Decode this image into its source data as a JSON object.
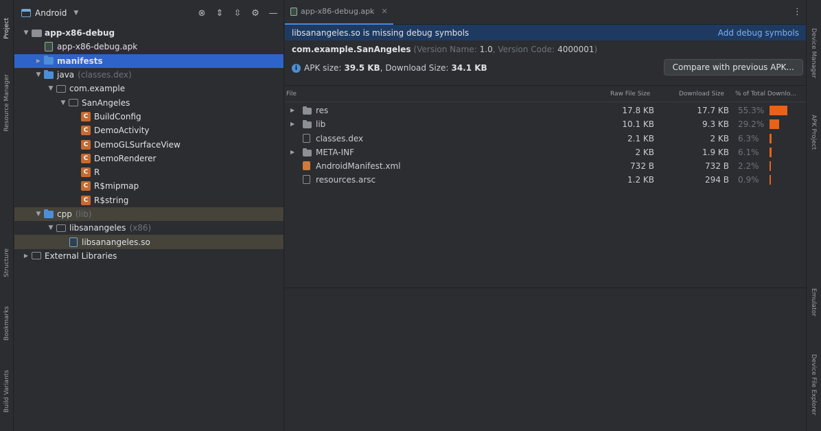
{
  "left_strip": [
    {
      "label": "Project",
      "icon": "folder-icon",
      "active": true
    },
    {
      "label": "Resource Manager",
      "icon": "resource-icon",
      "active": false
    },
    {
      "label": "Structure",
      "icon": "structure-icon",
      "active": false
    },
    {
      "label": "Bookmarks",
      "icon": "bookmark-icon",
      "active": false
    },
    {
      "label": "Build Variants",
      "icon": "build-variants-icon",
      "active": false
    }
  ],
  "right_strip": [
    {
      "label": "Device Manager",
      "icon": "device-icon"
    },
    {
      "label": "APK Project",
      "icon": "apk-icon"
    },
    {
      "label": "Emulator",
      "icon": "emulator-icon"
    },
    {
      "label": "Device File Explorer",
      "icon": "file-explorer-icon"
    }
  ],
  "project": {
    "view_label": "Android",
    "tree": [
      {
        "depth": 0,
        "arrow": "▾",
        "icon": "module",
        "name": "app-x86-debug",
        "bold": true,
        "sub": ""
      },
      {
        "depth": 1,
        "arrow": "",
        "icon": "apk",
        "name": "app-x86-debug.apk",
        "bold": false,
        "sub": ""
      },
      {
        "depth": 1,
        "arrow": "›",
        "icon": "folder-blue",
        "name": "manifests",
        "bold": true,
        "sub": "",
        "selected": true
      },
      {
        "depth": 1,
        "arrow": "▾",
        "icon": "folder-blue",
        "name": "java",
        "bold": false,
        "sub": "(classes.dex)"
      },
      {
        "depth": 2,
        "arrow": "▾",
        "icon": "package",
        "name": "com.example",
        "bold": false,
        "sub": ""
      },
      {
        "depth": 3,
        "arrow": "▾",
        "icon": "package",
        "name": "SanAngeles",
        "bold": false,
        "sub": ""
      },
      {
        "depth": 4,
        "arrow": "",
        "icon": "class",
        "name": "BuildConfig",
        "bold": false,
        "sub": ""
      },
      {
        "depth": 4,
        "arrow": "",
        "icon": "class",
        "name": "DemoActivity",
        "bold": false,
        "sub": ""
      },
      {
        "depth": 4,
        "arrow": "",
        "icon": "class",
        "name": "DemoGLSurfaceView",
        "bold": false,
        "sub": ""
      },
      {
        "depth": 4,
        "arrow": "",
        "icon": "class",
        "name": "DemoRenderer",
        "bold": false,
        "sub": ""
      },
      {
        "depth": 4,
        "arrow": "",
        "icon": "class",
        "name": "R",
        "bold": false,
        "sub": ""
      },
      {
        "depth": 4,
        "arrow": "",
        "icon": "class",
        "name": "R$mipmap",
        "bold": false,
        "sub": ""
      },
      {
        "depth": 4,
        "arrow": "",
        "icon": "class",
        "name": "R$string",
        "bold": false,
        "sub": ""
      },
      {
        "depth": 1,
        "arrow": "▾",
        "icon": "folder-blue",
        "name": "cpp",
        "bold": false,
        "sub": "(lib)",
        "hl": true
      },
      {
        "depth": 2,
        "arrow": "▾",
        "icon": "package",
        "name": "libsanangeles",
        "bold": false,
        "sub": "(x86)"
      },
      {
        "depth": 3,
        "arrow": "",
        "icon": "so",
        "name": "libsanangeles.so",
        "bold": false,
        "sub": "",
        "hl": true
      },
      {
        "depth": 0,
        "arrow": "›",
        "icon": "libraries",
        "name": "External Libraries",
        "bold": false,
        "sub": ""
      }
    ]
  },
  "editor": {
    "tab_label": "app-x86-debug.apk",
    "banner_message": "libsanangeles.so is missing debug symbols",
    "banner_action": "Add debug symbols",
    "package_name": "com.example.SanAngeles",
    "version_name_label": "(Version Name:",
    "version_name": "1.0",
    "version_code_label": ", Version Code:",
    "version_code": "4000001",
    "version_close": ")",
    "apk_size_label": "APK size:",
    "apk_size": "39.5 KB",
    "download_size_label": ", Download Size:",
    "download_size": "34.1 KB",
    "compare_button": "Compare with previous APK...",
    "columns": {
      "file": "File",
      "raw": "Raw File Size",
      "download": "Download Size",
      "percent": "% of Total Downlo..."
    },
    "files": [
      {
        "arrow": "›",
        "icon": "folder",
        "name": "res",
        "raw": "17.8 KB",
        "download": "17.7 KB",
        "percent": "55.3%",
        "fraction": 0.553
      },
      {
        "arrow": "›",
        "icon": "folder",
        "name": "lib",
        "raw": "10.1 KB",
        "download": "9.3 KB",
        "percent": "29.2%",
        "fraction": 0.292
      },
      {
        "arrow": "",
        "icon": "dex",
        "name": "classes.dex",
        "raw": "2.1 KB",
        "download": "2 KB",
        "percent": "6.3%",
        "fraction": 0.063
      },
      {
        "arrow": "›",
        "icon": "folder",
        "name": "META-INF",
        "raw": "2 KB",
        "download": "1.9 KB",
        "percent": "6.1%",
        "fraction": 0.061
      },
      {
        "arrow": "",
        "icon": "xml",
        "name": "AndroidManifest.xml",
        "raw": "732 B",
        "download": "732 B",
        "percent": "2.2%",
        "fraction": 0.022
      },
      {
        "arrow": "",
        "icon": "arsc",
        "name": "resources.arsc",
        "raw": "1.2 KB",
        "download": "294 B",
        "percent": "0.9%",
        "fraction": 0.009
      }
    ]
  },
  "colors": {
    "accent": "#2e64c9",
    "bar": "#e8621a",
    "banner": "#1f3a61",
    "link": "#7ab0f5"
  }
}
